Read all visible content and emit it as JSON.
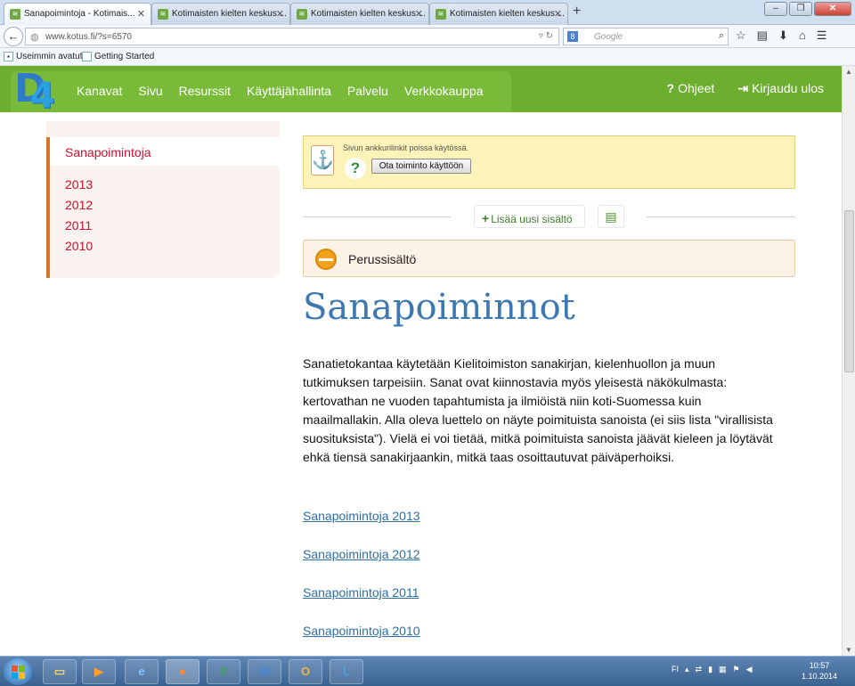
{
  "browser": {
    "tabs": [
      {
        "title": "Sanapoimintoja - Kotimais...",
        "active": true
      },
      {
        "title": "Kotimaisten kielten keskus ...",
        "active": false
      },
      {
        "title": "Kotimaisten kielten keskus ...",
        "active": false
      },
      {
        "title": "Kotimaisten kielten keskus ...",
        "active": false
      }
    ],
    "new_tab": "+",
    "url": "www.kotus.fi/?s=6570",
    "search_engine": "8",
    "search_placeholder": "Google",
    "bookmarks": [
      "Useimmin avatut",
      "Getting Started"
    ]
  },
  "site": {
    "logo_text": "P4",
    "menu": [
      "Kanavat",
      "Sivu",
      "Resurssit",
      "Käyttäjähallinta",
      "Palvelu",
      "Verkkokauppa"
    ],
    "help": "Ohjeet",
    "logout": "Kirjaudu ulos"
  },
  "sidebar": {
    "selected": "Sanapoimintoja",
    "years": [
      "2013",
      "2012",
      "2011",
      "2010"
    ]
  },
  "notice": {
    "message": "Sivun ankkurilinkit poissa käytössä.",
    "button": "Ota toiminto käyttöön"
  },
  "actions": {
    "add_content": "Lisää uusi sisältö"
  },
  "section": {
    "label": "Perussisältö"
  },
  "page": {
    "title": "Sanapoiminnot",
    "body_lines": [
      "Sanatietokantaa käytetään Kielitoimiston sanakirjan, kielenhuollon ja muun",
      "tutkimuksen tarpeisiin. Sanat ovat kiinnostavia myös yleisestä näkökulmasta:",
      "kertovathan ne vuoden tapahtumista ja ilmiöistä niin koti-Suomessa kuin",
      "maailmallakin. Alla oleva luettelo on näyte poimituista sanoista (ei siis lista \"virallisista",
      "suosituksista\"). Vielä ei voi tietää, mitkä poimituista sanoista jäävät kieleen ja löytävät",
      "ehkä tiensä sanakirjaankin, mitkä taas osoittautuvat päiväperhoiksi."
    ],
    "links": [
      "Sanapoimintoja 2013",
      "Sanapoimintoja 2012",
      "Sanapoimintoja 2011",
      "Sanapoimintoja 2010"
    ]
  },
  "taskbar": {
    "apps": [
      "explorer",
      "media-player",
      "internet-explorer",
      "firefox",
      "excel",
      "word",
      "outlook",
      "lync"
    ],
    "tray_lang": "FI",
    "time": "10:57",
    "date": "1.10.2014"
  }
}
